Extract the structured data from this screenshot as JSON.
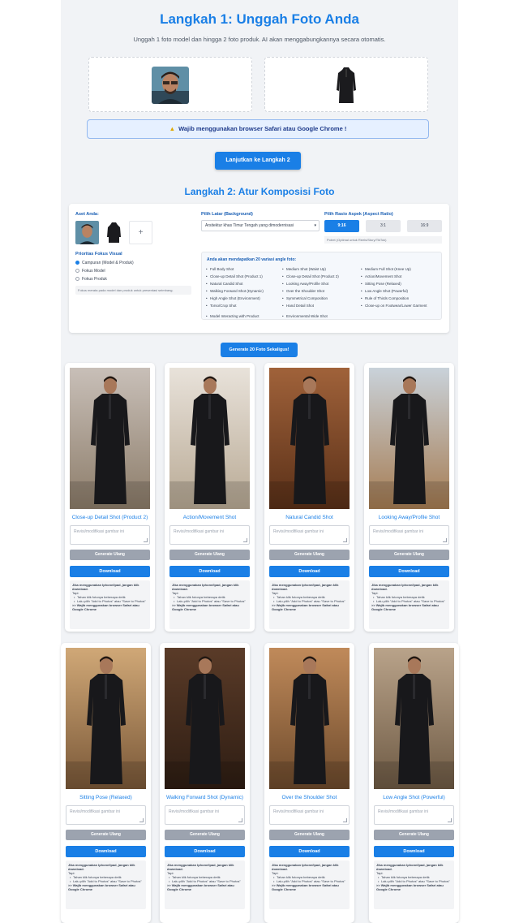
{
  "step1": {
    "title": "Langkah 1: Unggah Foto Anda",
    "subtitle": "Unggah 1 foto model dan hingga 2 foto produk. AI akan menggabungkannya secara otomatis.",
    "warning": "Wajib menggunakan browser Safari atau Google Chrome !",
    "warning_icon": "warning-icon",
    "next_button": "Lanjutkan ke Langkah 2"
  },
  "step2": {
    "title": "Langkah 2: Atur Komposisi Foto",
    "assets_label": "Aset Anda:",
    "add_icon": "+",
    "focus_label": "Prioritas Fokus Visual",
    "focus_options": [
      "Campuran (Model & Produk)",
      "Fokus Model",
      "Fokus Produk"
    ],
    "focus_selected": 0,
    "focus_note": "Fokus merata pada model dan produk untuk presentasi seimbang.",
    "background_label": "Pilih Latar (Background)",
    "background_value": "Arsitektur khas Timur Tengah yang dimodernisasi",
    "ratio_label": "Pilih Rasio Aspek (Aspect Ratio)",
    "ratios": [
      "9:16",
      "3:1",
      "16:9"
    ],
    "ratio_selected": 0,
    "ratio_note": "Potret (Optimal untuk Reels/Story/TikTok)",
    "angles_title": "Anda akan mendapatkan 20 variasi angle foto:",
    "angles": [
      "Full Body Shot",
      "Medium Shot (Waist Up)",
      "Medium Full Shot (Knee Up)",
      "Close-up Detail Shot (Product 1)",
      "Close-up Detail Shot (Product 2)",
      "Action/Movement Shot",
      "Natural Candid Shot",
      "Looking Away/Profile Shot",
      "Sitting Pose (Relaxed)",
      "Walking Forward Shot (Dynamic)",
      "Over the Shoulder Shot",
      "Low Angle Shot (Powerful)",
      "High Angle Shot (Environment)",
      "Symmetrical Composition",
      "Rule of Thirds Composition",
      "Torso/Crop Shot",
      "Hand Detail Shot",
      "Close-up on Footwear/Lower Garment",
      "Model Interacting with Product",
      "Environmental Wide Shot"
    ],
    "generate_button": "Generate 20 Foto Sekaligus!"
  },
  "card_common": {
    "placeholder": "Revisi/modifikasi gambar ini",
    "regen_button": "Generate Ulang",
    "download_button": "Download",
    "info_title": "Jika menggunakan Iphone/Ipad, jangan klik download.",
    "info_sub": "Tapi:",
    "info_items": [
      "Tahan klik fotonya beberapa detik",
      "Lalu pilih \"Add to Photos\" atau \"Save to Photos\""
    ],
    "info_footer": ">> Wajib menggunakan browser Safari atau Google Chrome"
  },
  "results": [
    {
      "title": "Close-up Detail Shot (Product 2)"
    },
    {
      "title": "Action/Movement Shot"
    },
    {
      "title": "Natural Candid Shot"
    },
    {
      "title": "Looking Away/Profile Shot"
    },
    {
      "title": "Sitting Pose (Relaxed)"
    },
    {
      "title": "Walking Forward Shot (Dynamic)"
    },
    {
      "title": "Over the Shoulder Shot"
    },
    {
      "title": "Low Angle Shot (Powerful)"
    }
  ]
}
